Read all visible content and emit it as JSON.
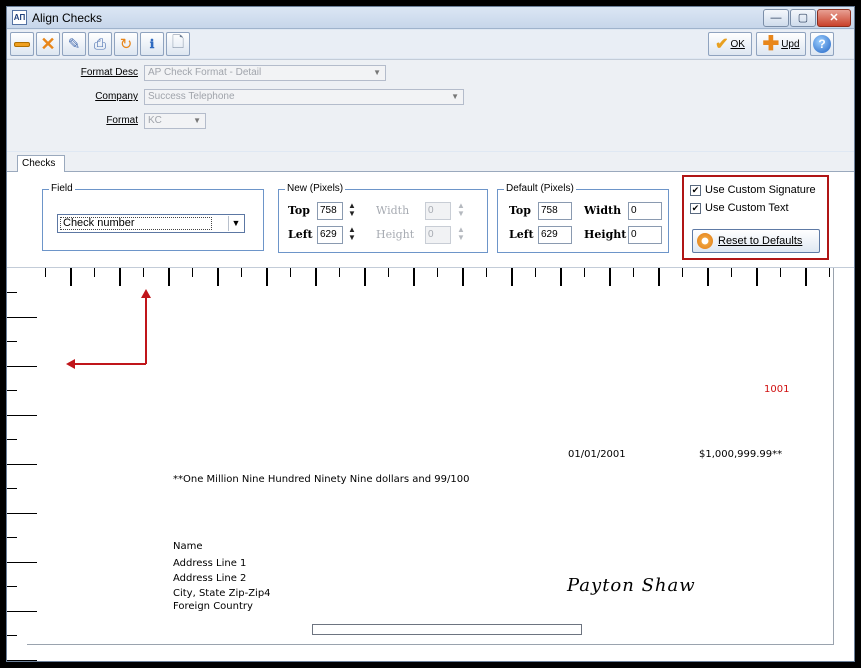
{
  "window": {
    "title": "Align Checks",
    "icon_text": "AΠ"
  },
  "title_buttons": {
    "minimize": "—",
    "maximize": "▢",
    "close": "✕"
  },
  "toolbar": {
    "left_icons": [
      "minus-icon",
      "delete-x-icon",
      "eraser-icon",
      "printer-icon",
      "refresh-icon",
      "document-info-icon",
      "page-icon"
    ],
    "ok_label": "OK",
    "upd_label": "Upd",
    "help_icon": "help-icon"
  },
  "format": {
    "desc_label": "Format Desc",
    "desc_value": "AP Check Format - Detail",
    "company_label": "Company",
    "company_value": "Success Telephone",
    "format_label": "Format",
    "format_value": "KC"
  },
  "tabs": [
    {
      "label": "Checks"
    }
  ],
  "field_group": {
    "title": "Field",
    "selected": "Check number"
  },
  "new_group": {
    "title": "New (Pixels)",
    "top_label": "Top",
    "top_value": "758",
    "left_label": "Left",
    "left_value": "629",
    "width_label": "Width",
    "width_value": "0",
    "height_label": "Height",
    "height_value": "0"
  },
  "default_group": {
    "title": "Default (Pixels)",
    "top_label": "Top",
    "top_value": "758",
    "left_label": "Left",
    "left_value": "629",
    "width_label": "Width",
    "width_value": "0",
    "height_label": "Height",
    "height_value": "0"
  },
  "custom": {
    "use_signature_label": "Use Custom Signature",
    "use_signature_checked": true,
    "use_text_label": "Use Custom Text",
    "use_text_checked": true,
    "reset_label": "Reset to Defaults"
  },
  "check_preview": {
    "check_number": "1001",
    "check_number_color": "#d01010",
    "date": "01/01/2001",
    "amount": "$1,000,999.99**",
    "amount_words": "**One Million Nine Hundred Ninety Nine dollars and 99/100",
    "address": [
      "Name",
      "Address Line 1",
      "Address Line 2",
      "City, State Zip-Zip4",
      "Foreign Country"
    ],
    "signature": "Payton Shaw"
  },
  "annotation_color": "#c0151a"
}
